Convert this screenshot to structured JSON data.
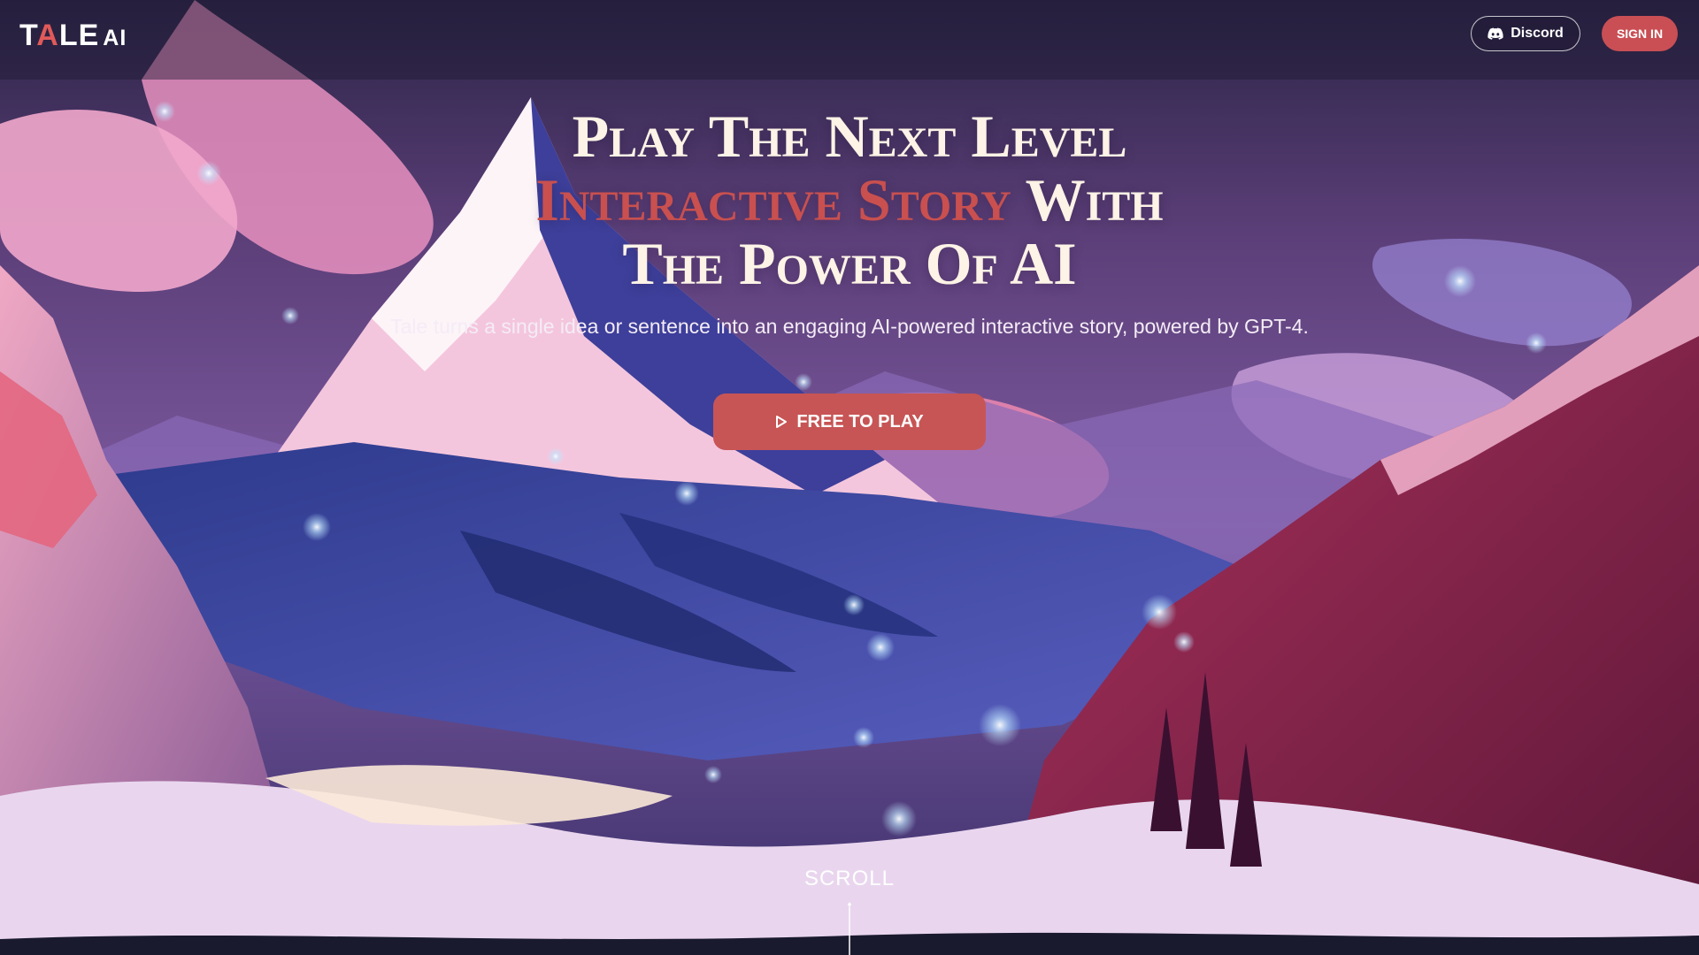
{
  "header": {
    "logo": {
      "text_main_pre": "T",
      "text_main_accent": "A",
      "text_main_post": "LE",
      "text_sub": "AI"
    },
    "discord_label": "Discord",
    "signin_label": "SIGN IN"
  },
  "hero": {
    "line1": "Play The Next Level",
    "line2_accent": "Interactive Story",
    "line2_rest": " With",
    "line3": "The Power Of AI",
    "subtitle": "Tale turns a single idea or sentence into an engaging AI-powered interactive story, powered by GPT-4.",
    "cta_label": "FREE TO PLAY",
    "scroll_label": "SCROLL"
  },
  "icons": {
    "discord": "discord-icon",
    "play": "play-icon",
    "scroll": "scroll-indicator-icon"
  },
  "colors": {
    "accent": "#c9504f",
    "cta": "#c75555",
    "title": "#fdf3e6"
  }
}
